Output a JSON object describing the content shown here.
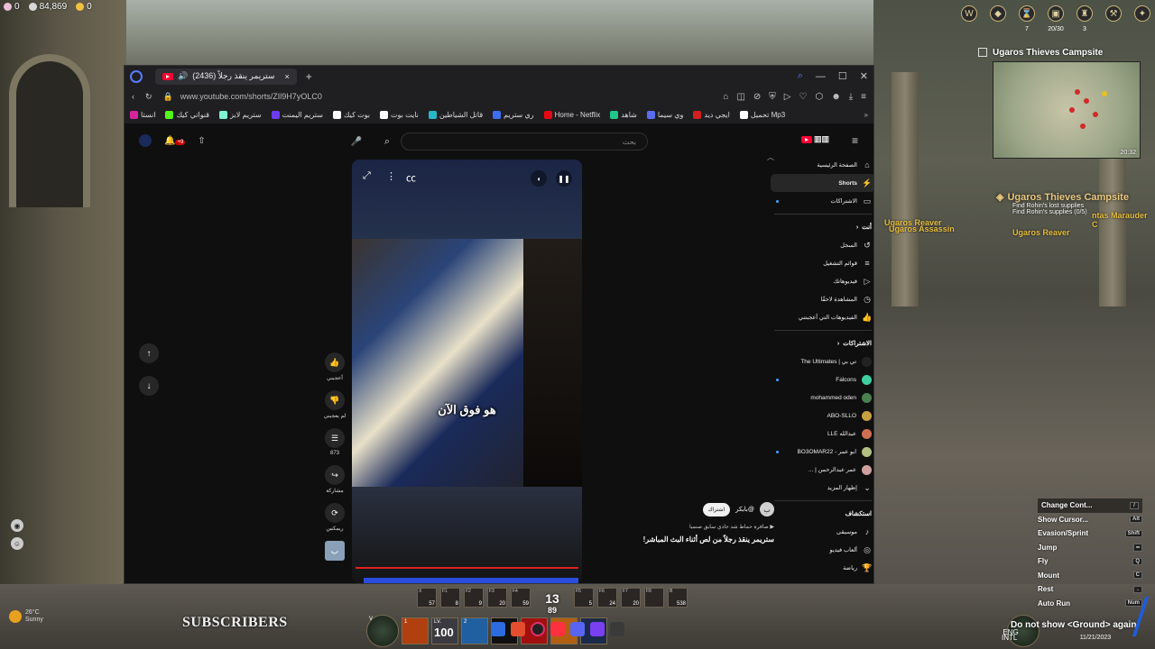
{
  "game": {
    "stats": [
      {
        "value": "0",
        "color": "#e8c0d8"
      },
      {
        "value": "84,869",
        "color": "#d8d8d8"
      },
      {
        "value": "0",
        "color": "#f0c040"
      }
    ],
    "hud_icons": [
      {
        "name": "quest-emblem-icon",
        "glyph": "W",
        "num": ""
      },
      {
        "name": "shield-icon",
        "glyph": "◆",
        "num": ""
      },
      {
        "name": "hourglass-icon",
        "glyph": "⌛",
        "num": "7"
      },
      {
        "name": "inventory-icon",
        "glyph": "▣",
        "num": "20/30"
      },
      {
        "name": "crown-icon",
        "glyph": "♜",
        "num": "3"
      },
      {
        "name": "pickaxe-icon",
        "glyph": "⚒",
        "num": ""
      },
      {
        "name": "menu-icon",
        "glyph": "✦",
        "num": ""
      }
    ],
    "map": {
      "location": "Ugaros Thieves Campsite",
      "time": "20:32"
    },
    "quest": {
      "title": "Ugaros Thieves Campsite",
      "steps": [
        "Find Rohin's lost supplies",
        "Find Rohin's supplies (0/5)"
      ]
    },
    "enemies": [
      "Ugaros Reaver",
      "Ugaros Assassin",
      "Ugaros Reaver",
      "ntas Marauder C"
    ],
    "key_hints": [
      {
        "label": "Change Cont...",
        "key": "/"
      },
      {
        "label": "Show Cursor...",
        "key": "Alt"
      },
      {
        "label": "Evasion/Sprint",
        "key": "Shift"
      },
      {
        "label": "Jump",
        "key": "━"
      },
      {
        "label": "Fly",
        "key": "Q"
      },
      {
        "label": "Mount",
        "key": "C"
      },
      {
        "label": "Rest",
        "key": "."
      },
      {
        "label": "Auto Run",
        "key": "Num"
      }
    ],
    "subscribers_text": "SUBSCRIBERS",
    "weather": {
      "temp": "26°C",
      "condition": "Sunny"
    },
    "level": {
      "main": "13",
      "sub": "89"
    },
    "top_slots": [
      {
        "key": "X",
        "num": "57"
      },
      {
        "key": "F1",
        "num": "8"
      },
      {
        "key": "F2",
        "num": "9"
      },
      {
        "key": "F3",
        "num": "20"
      },
      {
        "key": "F4",
        "num": "59"
      },
      {
        "key": "F5",
        "num": "5"
      },
      {
        "key": "F6",
        "num": "24"
      },
      {
        "key": "F7",
        "num": "20"
      },
      {
        "key": "F8",
        "num": ""
      },
      {
        "key": "B",
        "num": "538"
      }
    ],
    "skills": [
      {
        "key": "V",
        "value": ""
      },
      {
        "key": "1",
        "value": ""
      },
      {
        "key": "LV.",
        "value": "100"
      },
      {
        "key": "2",
        "value": ""
      }
    ],
    "notice": "Do not show <Ground> again",
    "tray": {
      "lang": "ENG",
      "region": "INTL",
      "date": "11/21/2023"
    }
  },
  "browser": {
    "tab_title": "(2436) ستريمر ينقذ رجلاً",
    "url": "www.youtube.com/shorts/ZIl9H7yOLC0",
    "bookmarks": [
      {
        "label": "انستا",
        "color": "#d6249f"
      },
      {
        "label": "قنواتي كيك",
        "color": "#53fc18"
      },
      {
        "label": "ستريم لابز",
        "color": "#80f5d2"
      },
      {
        "label": "ستريم اليمنت",
        "color": "#6c3cf0"
      },
      {
        "label": "بوت كيك",
        "color": "#ffffff"
      },
      {
        "label": "نايت بوت",
        "color": "#ffffff"
      },
      {
        "label": "قاتل الشياطين",
        "color": "#29b6c8"
      },
      {
        "label": "ري ستريم",
        "color": "#3d6df2"
      },
      {
        "label": "Home - Netflix",
        "color": "#e50914"
      },
      {
        "label": "شاهد",
        "color": "#22c58b"
      },
      {
        "label": "وي سيما",
        "color": "#5a6cf0"
      },
      {
        "label": "ايجي ديد",
        "color": "#d02020"
      },
      {
        "label": "تحميل Mp3",
        "color": "#ffffff"
      }
    ]
  },
  "youtube": {
    "search_placeholder": "بحث",
    "notif_badge": "+9",
    "video": {
      "caption": "هو فوق الآن",
      "actions": [
        {
          "name": "like",
          "icon": "👍",
          "label": "أعجبني"
        },
        {
          "name": "dislike",
          "icon": "👎",
          "label": "لم يعجبني"
        },
        {
          "name": "comments",
          "icon": "☰",
          "label": "873"
        },
        {
          "name": "share",
          "icon": "↪",
          "label": "مشاركة"
        },
        {
          "name": "remix",
          "icon": "⟳",
          "label": "ريمكس"
        }
      ],
      "channel_avatar": "ب",
      "channel_handle": "@بابكر",
      "subscribe": "اشتراك",
      "description": "▶ صافرة حماط شد جادي سابق صنميا",
      "title": "ستريمر ينقذ رجلاً من لص أثناء البث المباشر!"
    },
    "sidebar": {
      "main": [
        {
          "icon": "⌂",
          "label": "الصفحة الرئيسية",
          "active": false
        },
        {
          "icon": "⚡",
          "label": "Shorts",
          "active": true
        },
        {
          "icon": "▭",
          "label": "الاشتراكات",
          "active": false
        }
      ],
      "you_header": "أنت",
      "you": [
        {
          "icon": "↺",
          "label": "السجل"
        },
        {
          "icon": "≡",
          "label": "قوائم التشغيل"
        },
        {
          "icon": "▷",
          "label": "فيديوهاتك"
        },
        {
          "icon": "◷",
          "label": "المشاهدة لاحقًا"
        },
        {
          "icon": "👍",
          "label": "الفيديوهات التي أعجبتني"
        }
      ],
      "subs_header": "الاشتراكات",
      "subs": [
        {
          "label": "تي بي | The Ultimates",
          "color": "#222222",
          "dot": false
        },
        {
          "label": "Falcons",
          "color": "#3ecfa0",
          "dot": true
        },
        {
          "label": "mohammed oden",
          "color": "#4a8050",
          "dot": false
        },
        {
          "label": "ABO-SLLO",
          "color": "#c8a040",
          "dot": false
        },
        {
          "label": "عبدالله LLE",
          "color": "#d07050",
          "dot": false
        },
        {
          "label": "ابو عمر - BO3OMAR22",
          "color": "#b0c080",
          "dot": true
        },
        {
          "label": "عمر عبدالرحمن | ...",
          "color": "#d0a0a0",
          "dot": false
        }
      ],
      "show_more": "إظهار المزيد",
      "explore_header": "استكشاف",
      "explore": [
        {
          "icon": "♪",
          "label": "موسيقى"
        },
        {
          "icon": "◎",
          "label": "ألعاب فيديو"
        },
        {
          "icon": "🏆",
          "label": "رياضة"
        }
      ]
    }
  }
}
